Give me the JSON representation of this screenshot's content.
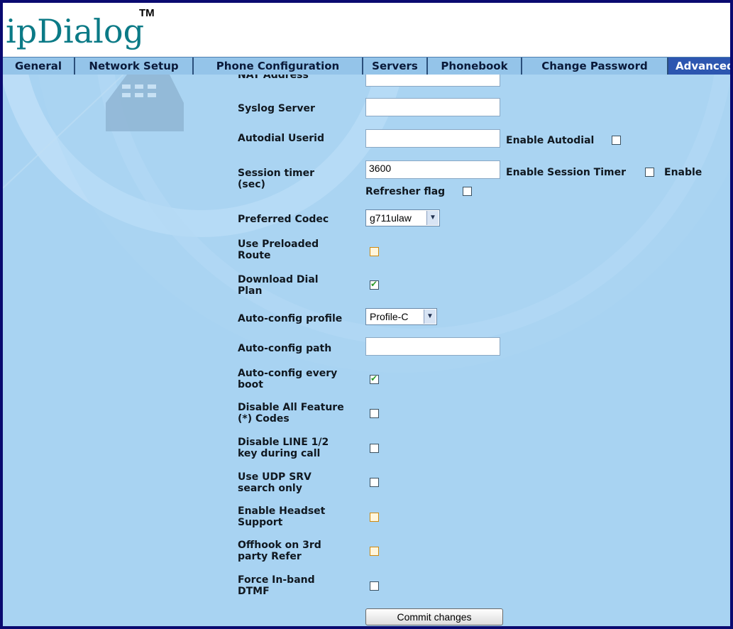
{
  "logo": {
    "text": "ipDialog",
    "tm": "TM"
  },
  "nav": {
    "tabs": [
      {
        "label": "General"
      },
      {
        "label": "Network Setup"
      },
      {
        "label": "Phone Configuration"
      },
      {
        "label": "Servers"
      },
      {
        "label": "Phonebook"
      },
      {
        "label": "Change Password"
      },
      {
        "label": "Advanced"
      }
    ],
    "active": "Advanced"
  },
  "form": {
    "nat_address_label": "NAT Address",
    "syslog_label": "Syslog Server",
    "syslog_value": "",
    "autodial_label": "Autodial Userid",
    "autodial_value": "",
    "enable_autodial_label": "Enable Autodial",
    "session_timer_label": "Session timer (sec)",
    "session_timer_value": "3600",
    "enable_session_timer_label": "Enable Session Timer",
    "enable_label": "Enable",
    "refresher_flag_label": "Refresher flag",
    "preferred_codec_label": "Preferred Codec",
    "preferred_codec_value": "g711ulaw",
    "use_preloaded_route_label": "Use Preloaded Route",
    "download_dial_plan_label": "Download Dial Plan",
    "auto_config_profile_label": "Auto-config profile",
    "auto_config_profile_value": "Profile-C",
    "auto_config_path_label": "Auto-config path",
    "auto_config_path_value": "",
    "auto_config_every_boot_label": "Auto-config every boot",
    "disable_feature_codes_label": "Disable All Feature (*) Codes",
    "disable_line_key_label": "Disable LINE 1/2 key during call",
    "use_udp_srv_label": "Use UDP SRV search only",
    "enable_headset_label": "Enable Headset Support",
    "offhook_refer_label": "Offhook on 3rd party Refer",
    "force_dtmf_label": "Force In-band DTMF",
    "commit_label": "Commit changes"
  },
  "checkboxes": {
    "enable_autodial": false,
    "enable_session_timer": false,
    "refresher_flag": false,
    "use_preloaded_route": false,
    "download_dial_plan": true,
    "auto_config_every_boot": true,
    "disable_feature_codes": false,
    "disable_line_key": false,
    "use_udp_srv": false,
    "enable_headset": false,
    "offhook_refer": false,
    "force_dtmf": false
  },
  "colors": {
    "frame": "#0a0a70",
    "nav_bg": "#94c4e9",
    "active_tab": "#2d56b0",
    "content_bg": "#a8d3f2",
    "logo": "#0b7a86"
  }
}
